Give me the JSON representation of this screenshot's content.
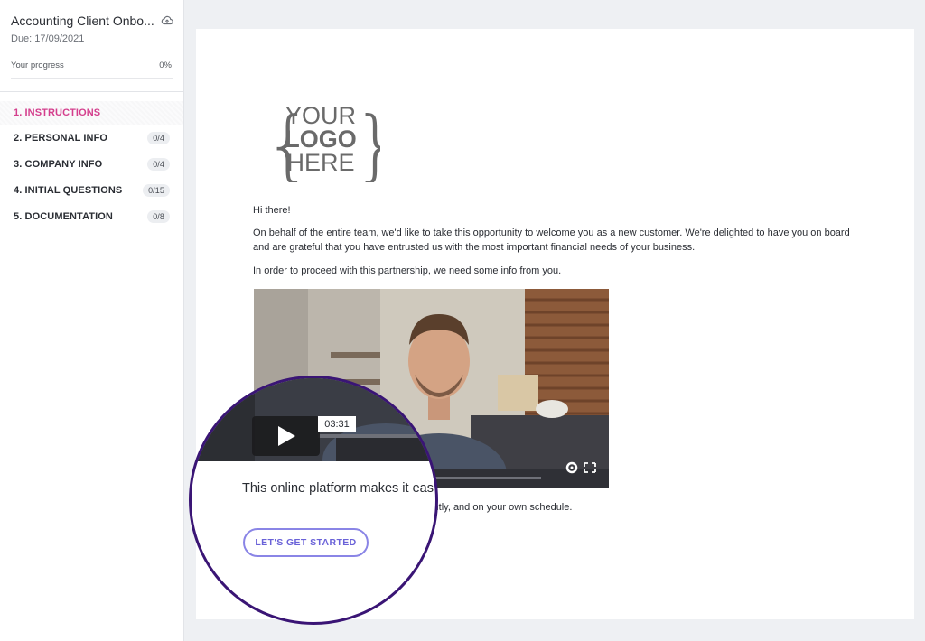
{
  "sidebar": {
    "title": "Accounting Client Onbo...",
    "due": "Due: 17/09/2021",
    "progress_label": "Your progress",
    "progress_value": "0%",
    "progress_fraction": 0,
    "items": [
      {
        "label": "1. INSTRUCTIONS",
        "count": "",
        "active": true
      },
      {
        "label": "2. PERSONAL INFO",
        "count": "0/4",
        "active": false
      },
      {
        "label": "3. COMPANY INFO",
        "count": "0/4",
        "active": false
      },
      {
        "label": "4. INITIAL QUESTIONS",
        "count": "0/15",
        "active": false
      },
      {
        "label": "5. DOCUMENTATION",
        "count": "0/8",
        "active": false
      }
    ]
  },
  "main": {
    "logo": {
      "line1": "YOUR",
      "line2": "LOGO",
      "line3": "HERE"
    },
    "greeting": "Hi there!",
    "paragraph1": "On behalf of the entire team, we'd like to take this opportunity to welcome you as a new customer. We're delighted to have you on board and are grateful that you have entrusted us with the most important financial needs of your business.",
    "paragraph2": "In order to proceed with this partnership, we need some info from you.",
    "after_video_text": "you to send us information quickly, efficiently, and on your own schedule."
  },
  "magnifier": {
    "video_time": "03:31",
    "text": "This online platform makes it eas",
    "button_label": "LET'S GET STARTED"
  },
  "colors": {
    "accent_pink": "#d43f8d",
    "button_purple": "#6a62d8",
    "magnifier_ring": "#3a1575"
  },
  "icons": [
    "cloud-icon",
    "play-icon",
    "gear-icon",
    "fullscreen-icon"
  ]
}
